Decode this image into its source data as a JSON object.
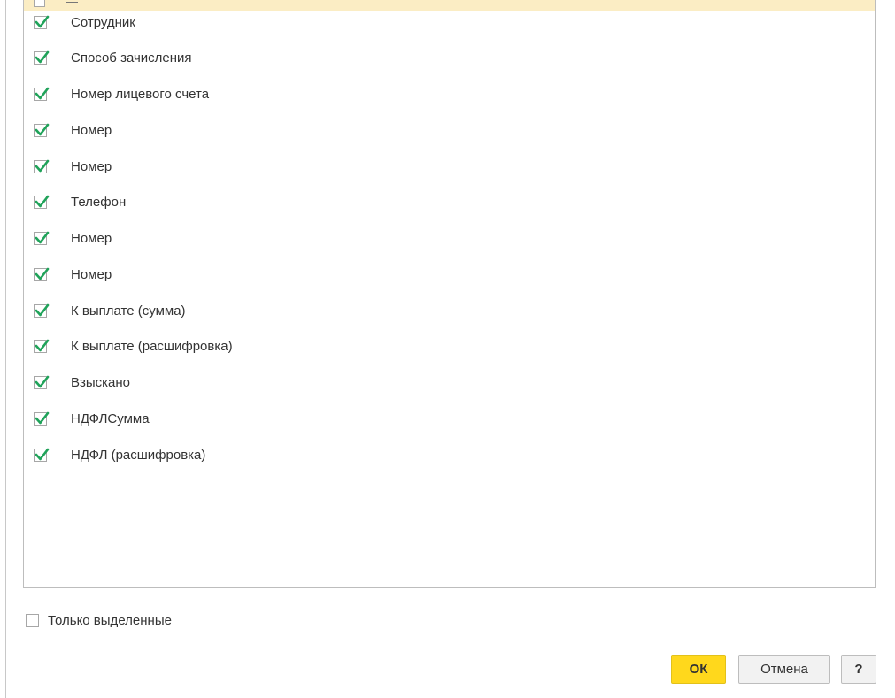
{
  "fields": [
    {
      "label": "Сотрудник",
      "checked": true
    },
    {
      "label": "Способ зачисления",
      "checked": true
    },
    {
      "label": "Номер лицевого счета",
      "checked": true
    },
    {
      "label": "Номер",
      "checked": true
    },
    {
      "label": "Номер",
      "checked": true
    },
    {
      "label": "Телефон",
      "checked": true
    },
    {
      "label": "Номер",
      "checked": true
    },
    {
      "label": "Номер",
      "checked": true
    },
    {
      "label": "К выплате (сумма)",
      "checked": true
    },
    {
      "label": "К выплате (расшифровка)",
      "checked": true
    },
    {
      "label": "Взыскано",
      "checked": true
    },
    {
      "label": "НДФЛСумма",
      "checked": true
    },
    {
      "label": "НДФЛ (расшифровка)",
      "checked": true
    }
  ],
  "only_selected": {
    "label": "Только выделенные",
    "checked": false
  },
  "buttons": {
    "ok": "ОК",
    "cancel": "Отмена",
    "help": "?"
  },
  "colors": {
    "checkmark": "#20a35a",
    "selected_row": "#fbedc4",
    "ok_button": "#ffd81c"
  }
}
